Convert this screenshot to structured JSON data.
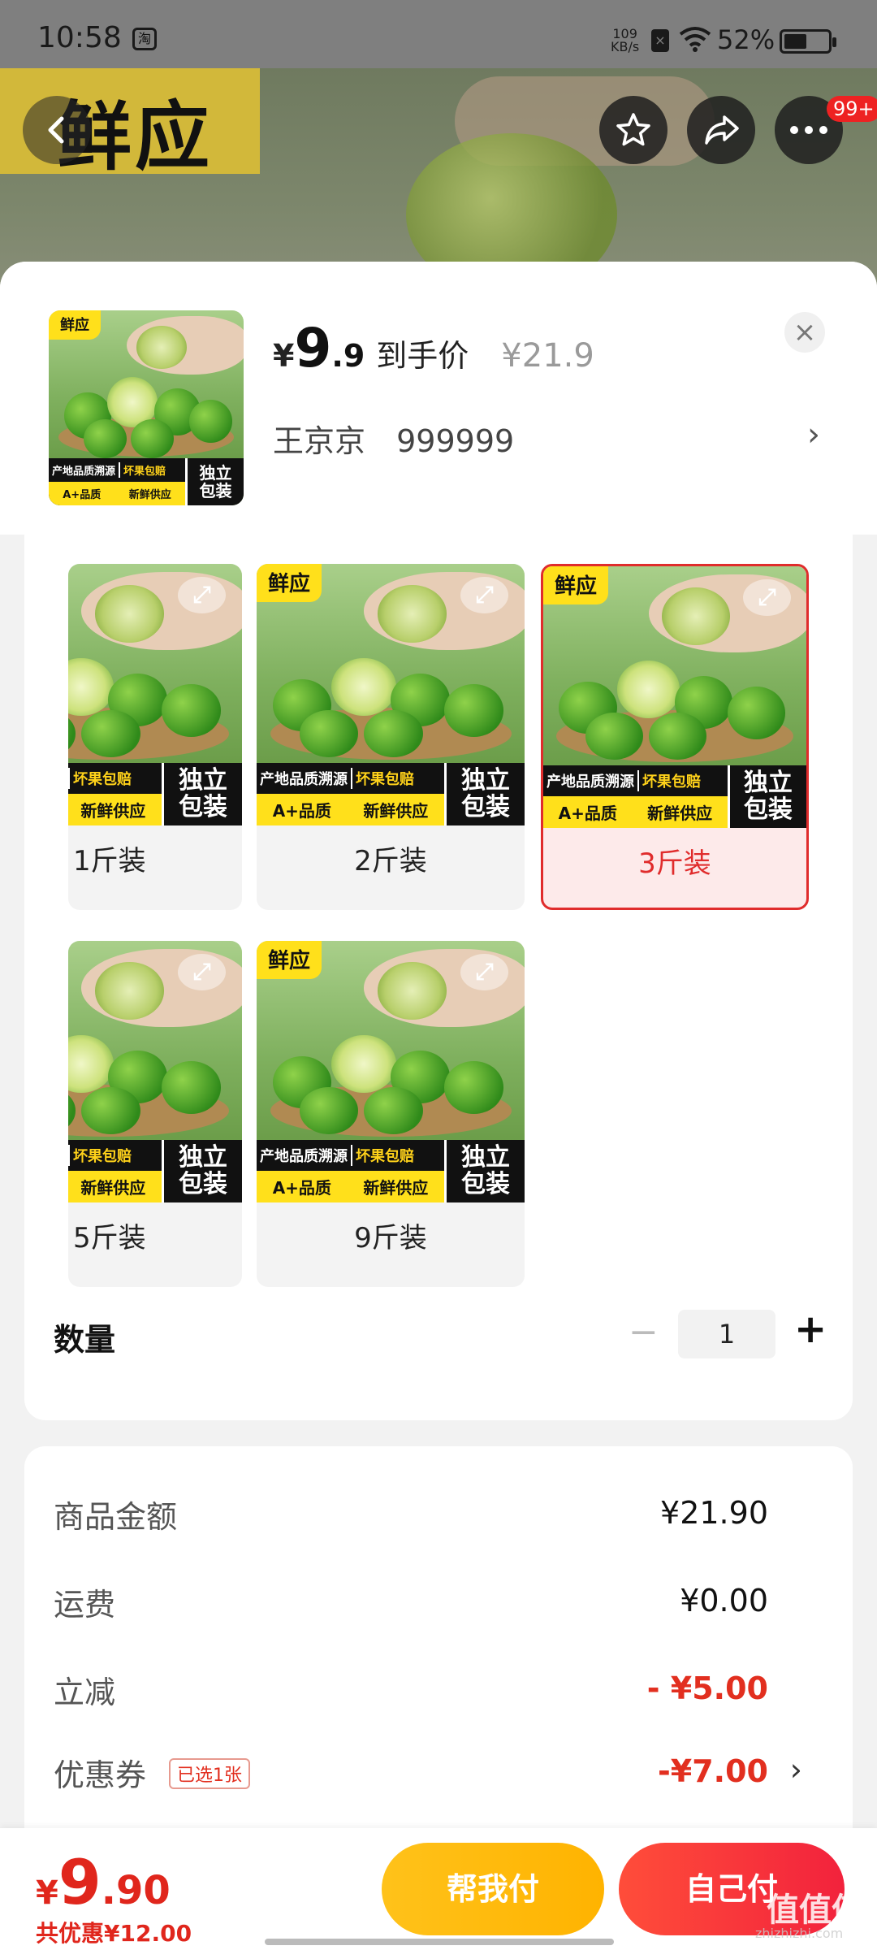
{
  "status_bar": {
    "time": "10:58",
    "app_icon": "淘",
    "net_speed_value": "109",
    "net_speed_unit": "KB/s",
    "battery": "52%",
    "battery_level": 0.52
  },
  "hero": {
    "brand_text": "鲜应",
    "notification_badge": "99+"
  },
  "product": {
    "thumb_tag": "鲜应",
    "currency": "¥",
    "price_int": "9",
    "price_dec": ".9",
    "price_label": "到手价",
    "original_price": "¥21.9",
    "user_name": "王京京",
    "user_id": "999999"
  },
  "image_text": {
    "tag": "鲜应",
    "origin": "产地品质溯源",
    "guarantee": "坏果包赔",
    "quality": "A+品质",
    "fresh": "新鲜供应",
    "pack1": "独立",
    "pack2": "包装",
    "zoom_icon": "⤢"
  },
  "options": [
    {
      "label": "1斤装",
      "selected": false
    },
    {
      "label": "2斤装",
      "selected": false
    },
    {
      "label": "3斤装",
      "selected": true
    },
    {
      "label": "5斤装",
      "selected": false
    },
    {
      "label": "9斤装",
      "selected": false
    }
  ],
  "quantity": {
    "label": "数量",
    "minus": "−",
    "value": "1",
    "plus": "+"
  },
  "summary": {
    "goods_amount_label": "商品金额",
    "goods_amount": "¥21.90",
    "shipping_label": "运费",
    "shipping": "¥0.00",
    "discount_label": "立减",
    "discount": "- ¥5.00",
    "coupon_label": "优惠券",
    "coupon_tag": "已选1张",
    "coupon": "-¥7.00",
    "chevron": "›"
  },
  "bottom": {
    "currency": "¥",
    "final_int": "9",
    "final_dec": ".90",
    "saved": "共优惠¥12.00",
    "help_pay": "帮我付",
    "self_pay": "自己付"
  },
  "watermark": {
    "main": "值值值",
    "sub": "zhizhizhi.com"
  },
  "colors": {
    "accent_red": "#e0261c",
    "yellow_button": "#ffc21a",
    "brand_yellow": "#ffe01b"
  }
}
